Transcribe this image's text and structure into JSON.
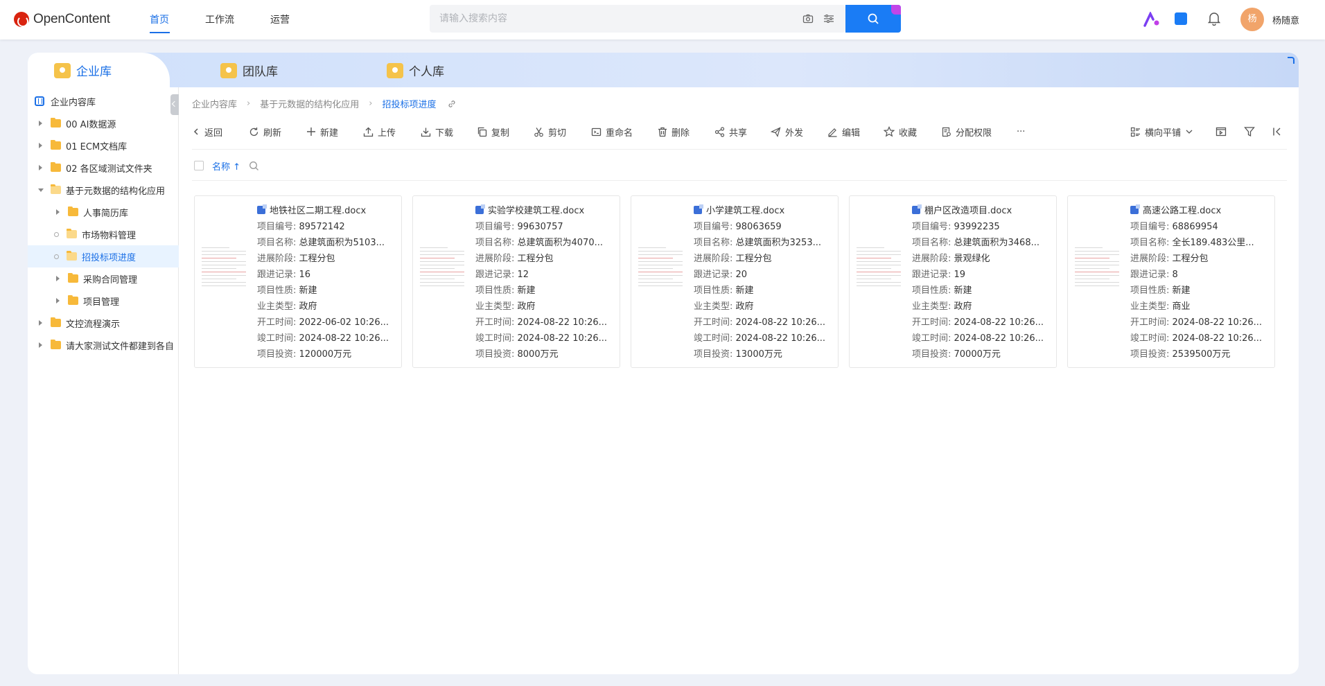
{
  "app": {
    "brand": "OpenContent"
  },
  "topnav": {
    "items": [
      "首页",
      "工作流",
      "运营"
    ],
    "active_index": 0
  },
  "search": {
    "placeholder": "请输入搜索内容"
  },
  "user": {
    "avatar_text": "杨",
    "name": "杨随意"
  },
  "tabs": [
    {
      "label": "企业库",
      "active": true
    },
    {
      "label": "团队库",
      "active": false
    },
    {
      "label": "个人库",
      "active": false
    }
  ],
  "sidebar": {
    "root": "企业内容库",
    "items": [
      {
        "label": "00 AI数据源",
        "level": 1,
        "state": "collapsed"
      },
      {
        "label": "01 ECM文档库",
        "level": 1,
        "state": "collapsed"
      },
      {
        "label": "02 各区域测试文件夹",
        "level": 1,
        "state": "collapsed"
      },
      {
        "label": "基于元数据的结构化应用",
        "level": 1,
        "state": "expanded"
      },
      {
        "label": "人事简历库",
        "level": 2,
        "state": "collapsed"
      },
      {
        "label": "市场物料管理",
        "level": 2,
        "state": "leaf"
      },
      {
        "label": "招投标项进度",
        "level": 2,
        "state": "leaf",
        "selected": true
      },
      {
        "label": "采购合同管理",
        "level": 2,
        "state": "collapsed"
      },
      {
        "label": "项目管理",
        "level": 2,
        "state": "collapsed"
      },
      {
        "label": "文控流程演示",
        "level": 1,
        "state": "collapsed"
      },
      {
        "label": "请大家测试文件都建到各自",
        "level": 1,
        "state": "collapsed"
      }
    ]
  },
  "breadcrumb": [
    "企业内容库",
    "基于元数据的结构化应用",
    "招投标项进度"
  ],
  "toolbar": {
    "back": "返回",
    "refresh": "刷新",
    "new": "新建",
    "upload": "上传",
    "download": "下载",
    "copy": "复制",
    "cut": "剪切",
    "rename": "重命名",
    "delete": "删除",
    "share": "共享",
    "send": "外发",
    "edit": "编辑",
    "favorite": "收藏",
    "permissions": "分配权限",
    "more": "···",
    "view_mode": "横向平铺"
  },
  "list_header": {
    "sort_label": "名称 ↑"
  },
  "field_labels": {
    "code": "项目编号: ",
    "name": "项目名称: ",
    "stage": "进展阶段: ",
    "records": "跟进记录: ",
    "nature": "项目性质: ",
    "owner": "业主类型: ",
    "start": "开工时间: ",
    "end": "竣工时间: ",
    "invest": "项目投资: "
  },
  "cards": [
    {
      "title": "地铁社区二期工程.docx",
      "code": "89572142",
      "name": "总建筑面积为5103...",
      "stage": "工程分包",
      "records": "16",
      "nature": "新建",
      "owner": "政府",
      "start": "2022-06-02 10:26...",
      "end": "2024-08-22 10:26...",
      "invest": "120000万元"
    },
    {
      "title": "实验学校建筑工程.docx",
      "code": "99630757",
      "name": "总建筑面积为4070...",
      "stage": "工程分包",
      "records": "12",
      "nature": "新建",
      "owner": "政府",
      "start": "2024-08-22 10:26...",
      "end": "2024-08-22 10:26...",
      "invest": "8000万元"
    },
    {
      "title": "小学建筑工程.docx",
      "code": "98063659",
      "name": "总建筑面积为3253...",
      "stage": "工程分包",
      "records": "20",
      "nature": "新建",
      "owner": "政府",
      "start": "2024-08-22 10:26...",
      "end": "2024-08-22 10:26...",
      "invest": "13000万元"
    },
    {
      "title": "棚户区改造项目.docx",
      "code": "93992235",
      "name": "总建筑面积为3468...",
      "stage": "景观绿化",
      "records": "19",
      "nature": "新建",
      "owner": "政府",
      "start": "2024-08-22 10:26...",
      "end": "2024-08-22 10:26...",
      "invest": "70000万元"
    },
    {
      "title": "高速公路工程.docx",
      "code": "68869954",
      "name": "全长189.483公里...",
      "stage": "工程分包",
      "records": "8",
      "nature": "新建",
      "owner": "商业",
      "start": "2024-08-22 10:26...",
      "end": "2024-08-22 10:26...",
      "invest": "2539500万元"
    }
  ]
}
